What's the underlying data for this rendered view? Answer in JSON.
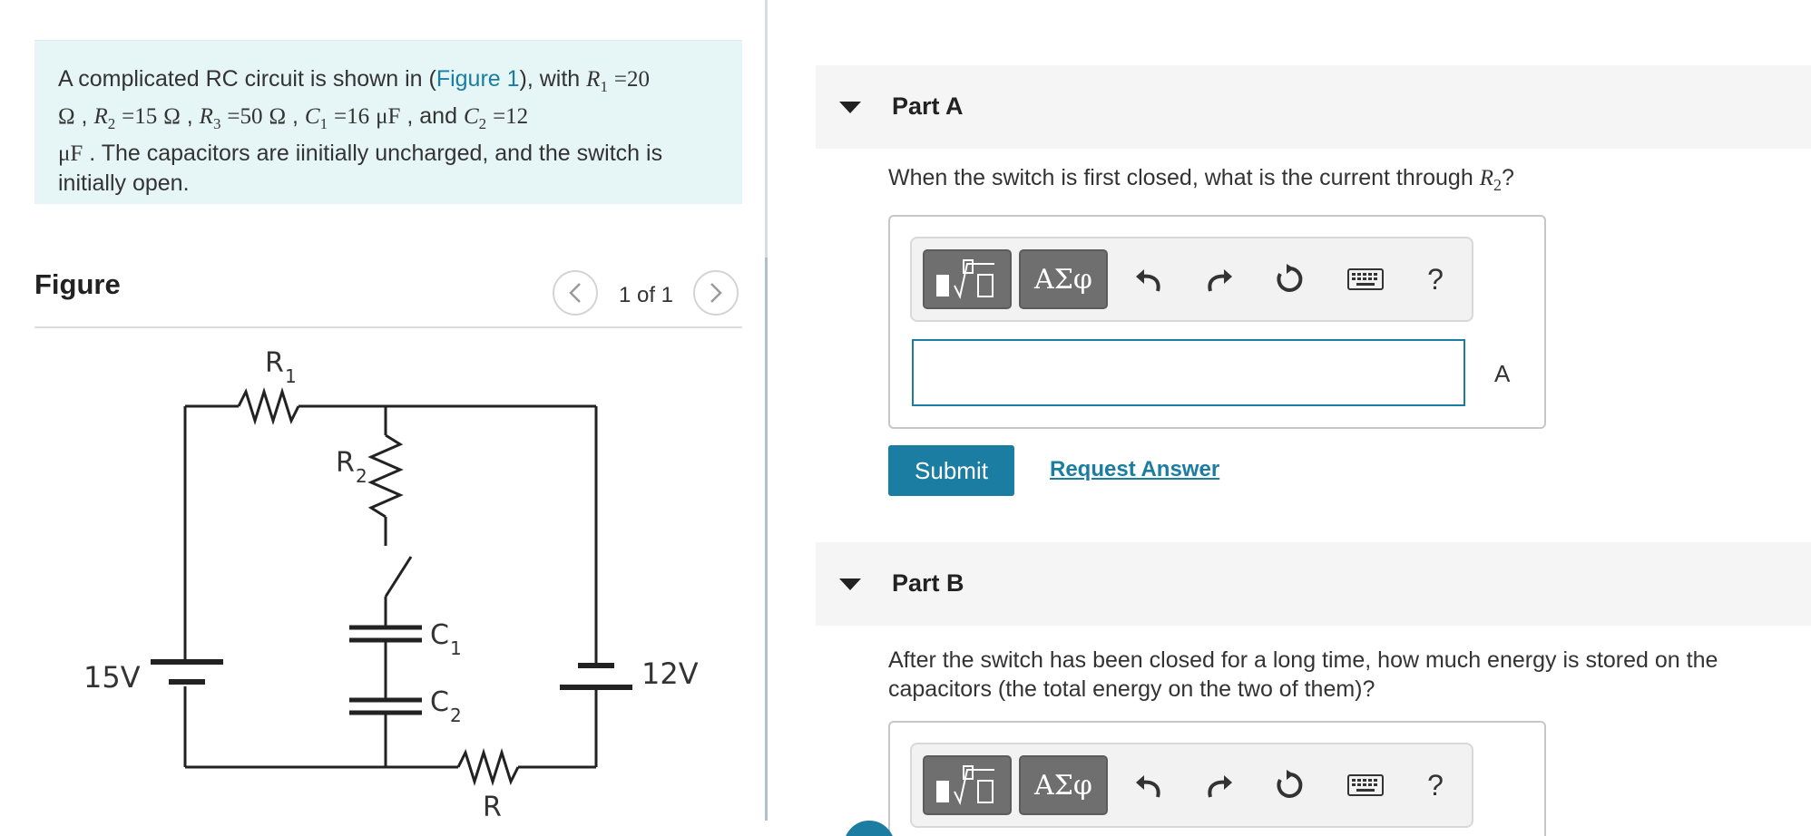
{
  "problem": {
    "text_intro": "A complicated RC circuit is shown in (",
    "figure_link": "Figure 1",
    "text_after_link": "), with ",
    "r1_sym": "R",
    "r1_sub": "1",
    "r1_val": "=20",
    "ohm": "Ω",
    "r2_sym": "R",
    "r2_sub": "2",
    "r2_val": "=15",
    "r3_sym": "R",
    "r3_sub": "3",
    "r3_val": "=50",
    "c1_sym": "C",
    "c1_sub": "1",
    "c1_val": "=16",
    "uf": "μF",
    "and": ", and",
    "c2_sym": "C",
    "c2_sub": "2",
    "c2_val": "=12",
    "rest": ". The capacitors are iinitially uncharged, and the switch is initially open."
  },
  "figure": {
    "title": "Figure",
    "count": "1 of 1",
    "prev_icon": "chevron-left-icon",
    "next_icon": "chevron-right-icon",
    "labels": {
      "r1": "R",
      "r1_sub": "1",
      "r2": "R",
      "r2_sub": "2",
      "c1": "C",
      "c1_sub": "1",
      "c2": "C",
      "c2_sub": "2",
      "v_left": "15V",
      "v_right": "12V",
      "r3_partial": "R"
    }
  },
  "partA": {
    "label": "Part A",
    "question_pre": "When the switch is first closed, what is the current through ",
    "q_sym": "R",
    "q_sub": "2",
    "question_post": "?",
    "input_value": "",
    "unit": "A",
    "submit": "Submit",
    "request": "Request Answer"
  },
  "partB": {
    "label": "Part B",
    "question": "After the switch has been closed for a long time, how much energy is stored on the capacitors (the total energy on the two of them)?"
  },
  "toolbar": {
    "greek": "ΑΣφ",
    "help": "?",
    "icons": [
      "templates-icon",
      "greek-icon",
      "undo-icon",
      "redo-icon",
      "reset-icon",
      "keyboard-icon",
      "help-icon"
    ]
  },
  "colors": {
    "accent": "#1a7da1",
    "problem_bg": "#e6f5f5",
    "part_bg": "#f5f5f5",
    "toolbar_btn": "#6f6f6f"
  }
}
